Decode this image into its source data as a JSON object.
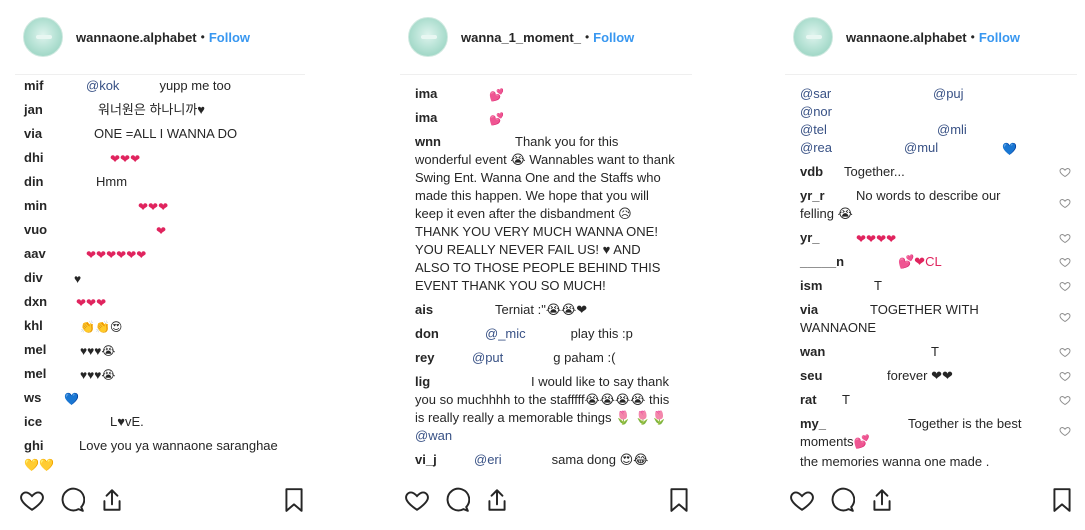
{
  "panels": [
    {
      "username": "wannaone.alphabet",
      "separator": "•",
      "follow_label": "Follow",
      "comments": [
        {
          "user": "mif",
          "mention": "@kok",
          "text": "yupp me too"
        },
        {
          "user": "jan",
          "text": "워너원은 하나니까♥"
        },
        {
          "user": "via",
          "text": "ONE =ALL I WANNA DO"
        },
        {
          "user": "dhi",
          "text": "❤❤❤"
        },
        {
          "user": "din",
          "text": "Hmm"
        },
        {
          "user": "min",
          "text": "❤❤❤"
        },
        {
          "user": "vuo",
          "text": "❤"
        },
        {
          "user": "aav",
          "text": "❤❤❤❤❤❤"
        },
        {
          "user": "div",
          "text": "♥"
        },
        {
          "user": "dxn",
          "text": "❤❤❤"
        },
        {
          "user": "khl",
          "text": "👏👏😍"
        },
        {
          "user": "mel",
          "text": "♥♥♥😭"
        },
        {
          "user": "mel",
          "text": "♥♥♥😭"
        },
        {
          "user": "ws",
          "text": "💙"
        },
        {
          "user": "ice",
          "text": "L♥vE."
        },
        {
          "user": "ghi",
          "text": "Love you ya wannaone saranghae",
          "text2": "💛💛"
        }
      ]
    },
    {
      "username": "wanna_1_moment_",
      "separator": "•",
      "follow_label": "Follow",
      "comments": [
        {
          "user": "ima",
          "text": "💕"
        },
        {
          "user": "ima",
          "text": "💕"
        },
        {
          "user": "wnn",
          "text": "Thank you for this",
          "text2": "wonderful event 😭 Wannables want to thank Swing Ent. Wanna One and the Staffs who made this happen. We hope that you will keep it even after the disbandment 😥 THANK YOU VERY MUCH WANNA ONE! YOU REALLY NEVER FAIL US! ♥ AND ALSO TO THOSE PEOPLE BEHIND THIS EVENT THANK YOU SO MUCH!"
        },
        {
          "user": "ais",
          "text": "Terniat :\"😭😭❤"
        },
        {
          "user": "don",
          "mention": "@_mic",
          "text": "play this :p"
        },
        {
          "user": "rey",
          "mention": "@put",
          "text": "g paham :("
        },
        {
          "user": "lig",
          "text": "I would like to say thank",
          "text2": "you so muchhhh to the stafffff😭😭😭😭 this is really really a memorable things 🌷 🌷🌷",
          "mention2": "@wan"
        },
        {
          "user": "vi_j",
          "mention": "@eri",
          "text": "sama dong 😍😂"
        }
      ]
    },
    {
      "username": "wannaone.alphabet",
      "separator": "•",
      "follow_label": "Follow",
      "comments": [
        {
          "mentions": [
            "@sar",
            "@puj"
          ]
        },
        {
          "mentions": [
            "@nor"
          ]
        },
        {
          "mentions": [
            "@tel",
            "@mli"
          ]
        },
        {
          "mentions": [
            "@rea",
            "@mul"
          ],
          "text": "💙"
        },
        {
          "user": "vdb",
          "text": "Together..."
        },
        {
          "user": "yr_r",
          "text": "No words to describe our",
          "text2": "felling 😭"
        },
        {
          "user": "yr_",
          "text": "❤❤❤❤"
        },
        {
          "user": "_____n",
          "text": "💕❤CL"
        },
        {
          "user": "ism",
          "text": "T"
        },
        {
          "user": "via",
          "text": "TOGETHER WITH",
          "text2": "WANNAONE"
        },
        {
          "user": "wan",
          "text": "T"
        },
        {
          "user": "seu",
          "text": "forever ❤❤"
        },
        {
          "user": "rat",
          "text": "T"
        },
        {
          "user": "my_",
          "text": "Together is the best",
          "text2": "moments💕"
        },
        {
          "text": "the memories wanna one made ."
        }
      ]
    }
  ]
}
